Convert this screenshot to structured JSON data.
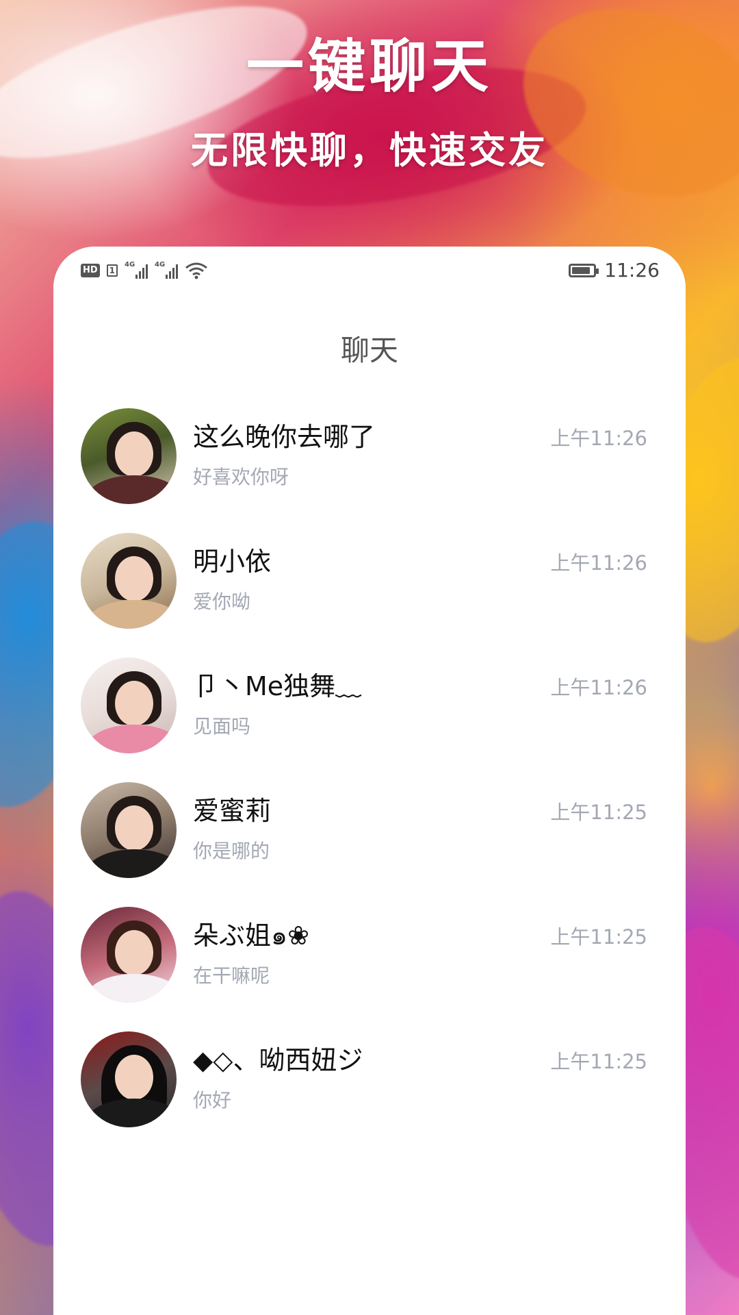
{
  "promo": {
    "headline": "一键聊天",
    "subline": "无限快聊，快速交友"
  },
  "status_bar": {
    "hd_label": "HD",
    "sim_label": "1",
    "network_1": "4G",
    "network_2": "4G",
    "time": "11:26",
    "battery_level_percent": 85
  },
  "app": {
    "title": "聊天"
  },
  "chats": [
    {
      "name": "这么晚你去哪了",
      "preview": "好喜欢你呀",
      "time": "上午11:26"
    },
    {
      "name": "明小依",
      "preview": "爱你呦",
      "time": "上午11:26"
    },
    {
      "name": "卩丶Me独舞﹏",
      "preview": "见面吗",
      "time": "上午11:26"
    },
    {
      "name": "爱蜜莉",
      "preview": "你是哪的",
      "time": "上午11:25"
    },
    {
      "name": "朵ぶ姐๑❀",
      "preview": "在干嘛呢",
      "time": "上午11:25"
    },
    {
      "name": "◆◇、呦西妞ジ",
      "preview": "你好",
      "time": "上午11:25"
    }
  ],
  "colors": {
    "accent_white": "#ffffff",
    "name_text": "#111111",
    "secondary_text": "#a3a8b3",
    "title_text": "#555555"
  }
}
